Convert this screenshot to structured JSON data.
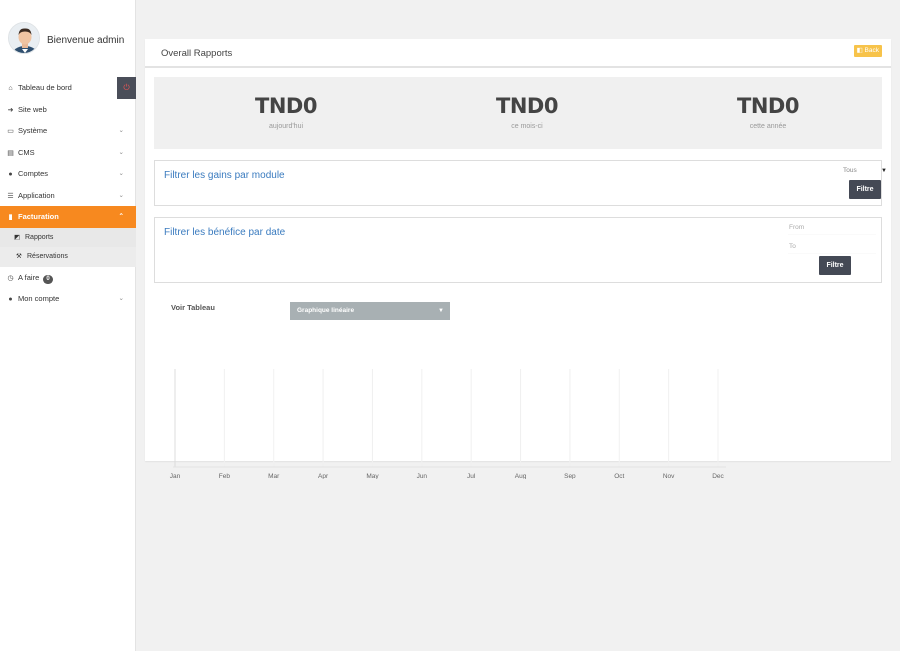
{
  "sidebar": {
    "welcome": "Bienvenue admin",
    "items": [
      {
        "label": "Tableau de bord",
        "icon": "home-icon",
        "glyph": "⌂"
      },
      {
        "label": "Site web",
        "icon": "sign-in-icon",
        "glyph": "➜"
      },
      {
        "label": "Système",
        "icon": "laptop-icon",
        "glyph": "▭",
        "chevron": "⌄"
      },
      {
        "label": "CMS",
        "icon": "book-icon",
        "glyph": "▤",
        "chevron": "⌄"
      },
      {
        "label": "Comptes",
        "icon": "user-icon",
        "glyph": "●",
        "chevron": "⌄"
      },
      {
        "label": "Application",
        "icon": "list-icon",
        "glyph": "☰",
        "chevron": "⌄"
      },
      {
        "label": "Facturation",
        "icon": "file-icon",
        "glyph": "▮",
        "chevron": "⌃"
      }
    ],
    "submenu": [
      {
        "label": "Rapports",
        "icon": "chart-icon",
        "glyph": "◩"
      },
      {
        "label": "Réservations",
        "icon": "gavel-icon",
        "glyph": "⚒"
      }
    ],
    "afaire": {
      "label": "A faire",
      "badge": "0",
      "glyph": "◷"
    },
    "moncompte": {
      "label": "Mon compte",
      "glyph": "●",
      "chevron": "⌄"
    },
    "power_glyph": "⏻"
  },
  "panel": {
    "title": "Overall Rapports",
    "back_label": "Back",
    "back_glyph": "◧"
  },
  "stats": [
    {
      "value": "TND0",
      "label": "aujourd'hui"
    },
    {
      "value": "TND0",
      "label": "ce mois-ci"
    },
    {
      "value": "TND0",
      "label": "cette année"
    }
  ],
  "filter_module": {
    "title": "Filtrer les gains par module",
    "select_value": "Tous",
    "button": "Filtre"
  },
  "filter_date": {
    "title": "Filtrer les bénéfice par date",
    "from_placeholder": "From",
    "to_placeholder": "To",
    "button": "Filtre"
  },
  "chart_controls": {
    "voir_label": "Voir Tableau",
    "select_value": "Graphique linéaire"
  },
  "chart_data": {
    "type": "line",
    "categories": [
      "Jan",
      "Feb",
      "Mar",
      "Apr",
      "May",
      "Jun",
      "Jul",
      "Aug",
      "Sep",
      "Oct",
      "Nov",
      "Dec"
    ],
    "series": [],
    "grid": true,
    "title": "",
    "xlabel": "",
    "ylabel": ""
  },
  "colors": {
    "accent": "#f7891f",
    "link": "#3a7bbf",
    "dark_button": "#444955",
    "back_button": "#f7c34a"
  }
}
